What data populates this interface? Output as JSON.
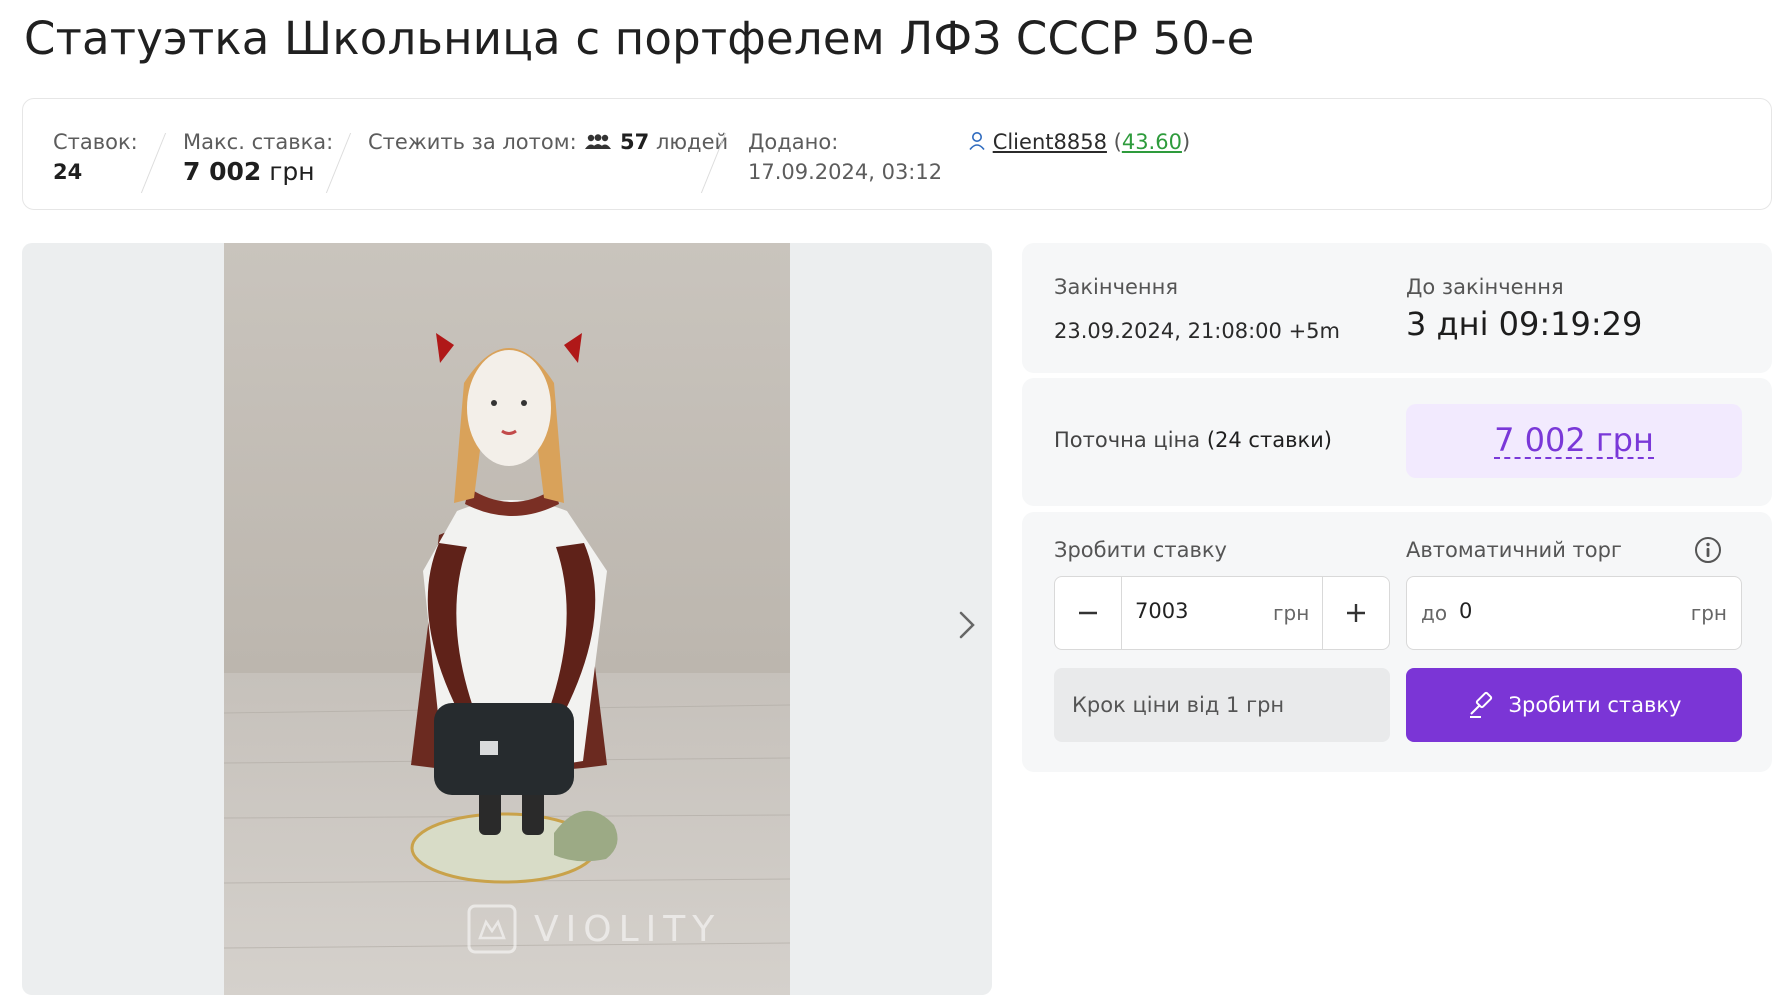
{
  "title": "Статуэтка Школьница с портфелем ЛФЗ СССР 50-е",
  "info": {
    "bids_label": "Ставок:",
    "bids_value": "24",
    "max_bid_label": "Макс. ставка:",
    "max_bid_value": "7 002",
    "max_bid_currency": "грн",
    "watch_label": "Стежить за лотом:",
    "watch_count": "57",
    "watch_suffix": "людей",
    "added_label": "Додано:",
    "added_value": "17.09.2024, 03:12",
    "seller_name": "Client8858",
    "seller_rating": "43.60"
  },
  "gallery": {
    "watermark": "VIOLITY"
  },
  "end": {
    "label": "Закінчення",
    "value": "23.09.2024, 21:08:00 +5m",
    "countdown_label": "До закінчення",
    "countdown_value": "3 дні 09:19:29"
  },
  "price": {
    "label": "Поточна ціна",
    "bids_note": "(24 ставки)",
    "value": "7 002 грн"
  },
  "bid": {
    "make_label": "Зробити ставку",
    "amount": "7003",
    "currency": "грн",
    "auto_label": "Автоматичний торг",
    "auto_prefix": "до",
    "auto_amount": "0",
    "auto_currency": "грн",
    "step_text": "Крок ціни від 1 грн",
    "submit_label": "Зробити ставку"
  },
  "colors": {
    "accent": "#7b35d6",
    "price_bg": "#f2eafe",
    "rating": "#2e9b3c"
  }
}
